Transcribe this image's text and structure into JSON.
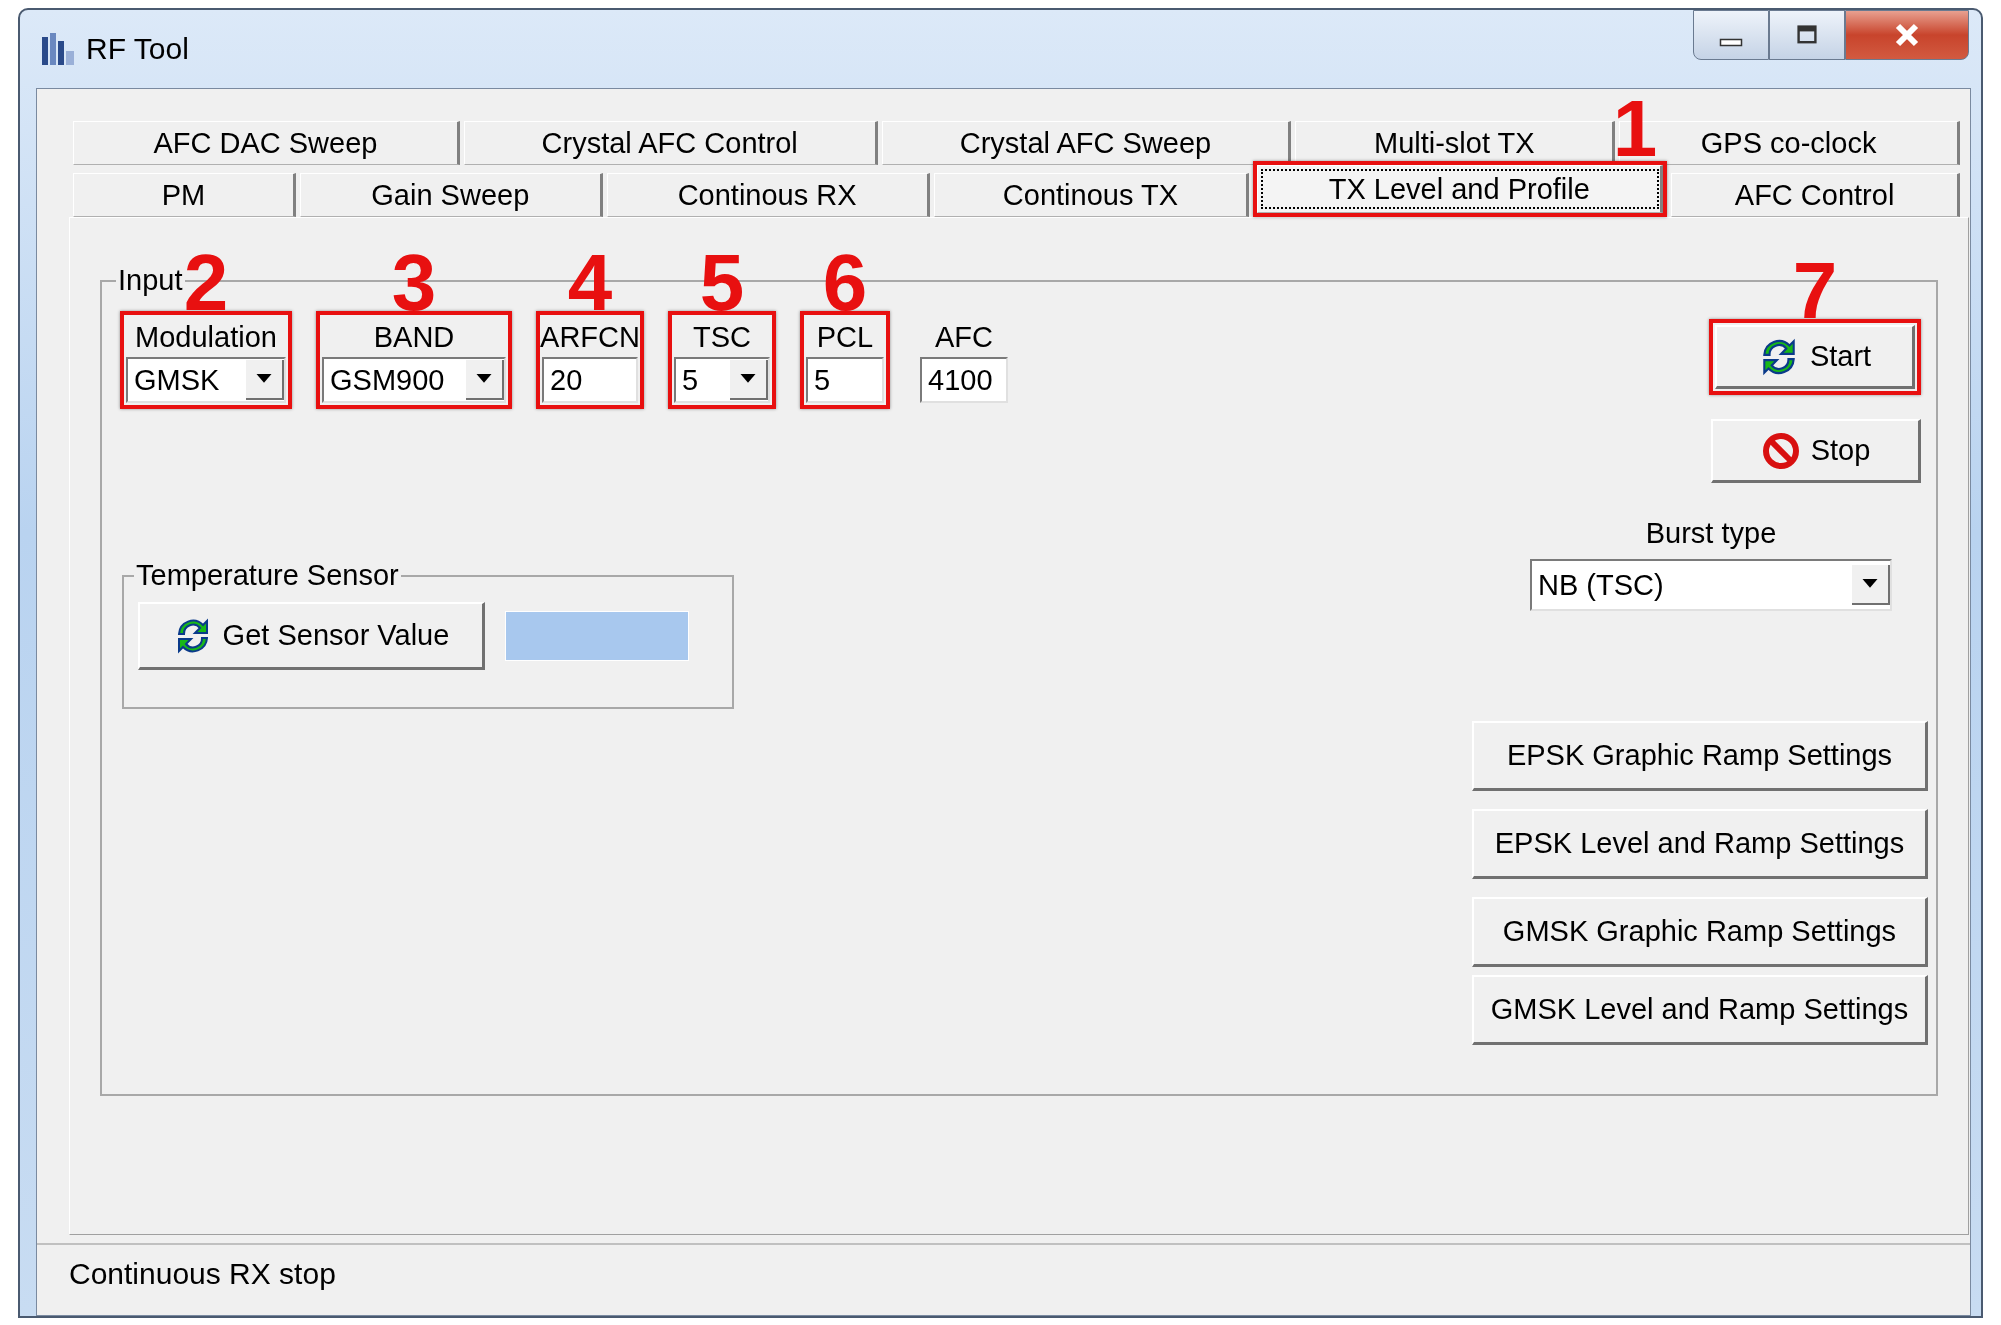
{
  "window": {
    "title": "RF Tool"
  },
  "tab_rows": [
    [
      {
        "label": "AFC DAC Sweep",
        "selected": false
      },
      {
        "label": "Crystal AFC Control",
        "selected": false
      },
      {
        "label": "Crystal AFC Sweep",
        "selected": false
      },
      {
        "label": "Multi-slot TX",
        "selected": false
      },
      {
        "label": "GPS co-clock",
        "selected": false
      }
    ],
    [
      {
        "label": "PM",
        "selected": false
      },
      {
        "label": "Gain Sweep",
        "selected": false
      },
      {
        "label": "Continous RX",
        "selected": false
      },
      {
        "label": "Continous TX",
        "selected": false
      },
      {
        "label": "TX Level and Profile",
        "selected": true,
        "callout": "1"
      },
      {
        "label": "AFC Control",
        "selected": false
      }
    ]
  ],
  "input_group": {
    "title": "Input",
    "fields": [
      {
        "kind": "combo",
        "label": "Modulation",
        "value": "GMSK",
        "callout": "2"
      },
      {
        "kind": "combo",
        "label": "BAND",
        "value": "GSM900",
        "callout": "3"
      },
      {
        "kind": "text",
        "label": "ARFCN",
        "value": "20",
        "callout": "4"
      },
      {
        "kind": "combo",
        "label": "TSC",
        "value": "5",
        "callout": "5"
      },
      {
        "kind": "text",
        "label": "PCL",
        "value": "5",
        "callout": "6"
      },
      {
        "kind": "text",
        "label": "AFC",
        "value": "4100"
      }
    ]
  },
  "temperature_sensor": {
    "title": "Temperature Sensor",
    "button": "Get Sensor Value"
  },
  "start_button": {
    "label": "Start",
    "callout": "7"
  },
  "stop_button": {
    "label": "Stop"
  },
  "burst_type": {
    "label": "Burst type",
    "value": "NB (TSC)"
  },
  "ramp_buttons": [
    "EPSK Graphic Ramp Settings",
    "EPSK Level and Ramp Settings",
    "GMSK Graphic Ramp Settings",
    "GMSK Level and Ramp Settings"
  ],
  "status_bar": "Continuous RX stop"
}
